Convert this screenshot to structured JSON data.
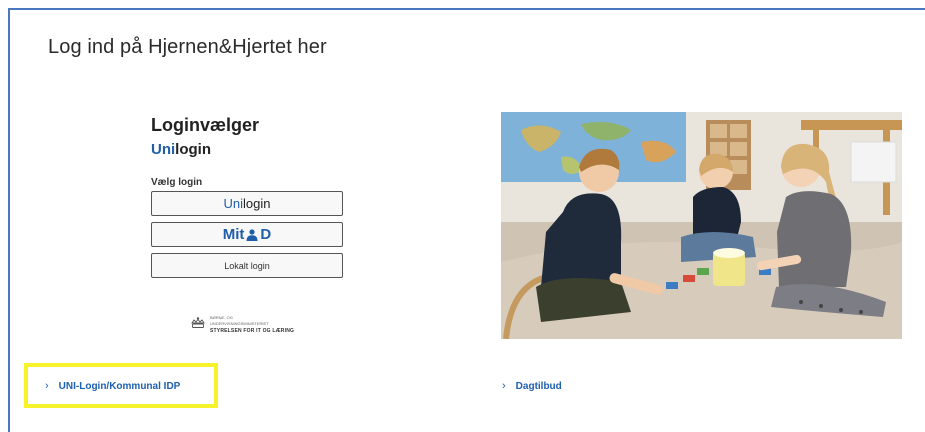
{
  "page": {
    "title": "Log ind på Hjernen&Hjertet her"
  },
  "login_panel": {
    "title": "Loginvælger",
    "subtitle_brand": "Uni",
    "subtitle_rest": "login",
    "choose_label": "Vælg login",
    "buttons": [
      {
        "brand": "Uni",
        "rest": "login"
      },
      {
        "text_before": "Mit",
        "text_after": "D",
        "icon": "mitid-person-icon"
      },
      {
        "label": "Lokalt login"
      }
    ],
    "ministry_logo": {
      "lines": [
        "BØRNE- OG",
        "UNDERVISNINGSMINISTERIET"
      ],
      "agency": "STYRELSEN FOR IT OG LÆRING",
      "icon": "crown-icon"
    }
  },
  "photo": {
    "description_icon": "children-playing-photo"
  },
  "links": [
    {
      "label": "UNI-Login/Kommunal IDP",
      "icon": "chevron-right-icon"
    },
    {
      "label": "Dagtilbud",
      "icon": "chevron-right-icon"
    }
  ],
  "colors": {
    "brand_blue": "#1f5ea8",
    "link_blue": "#1d5fb0",
    "highlight": "#f7f32a",
    "frame": "#4a78c2"
  }
}
